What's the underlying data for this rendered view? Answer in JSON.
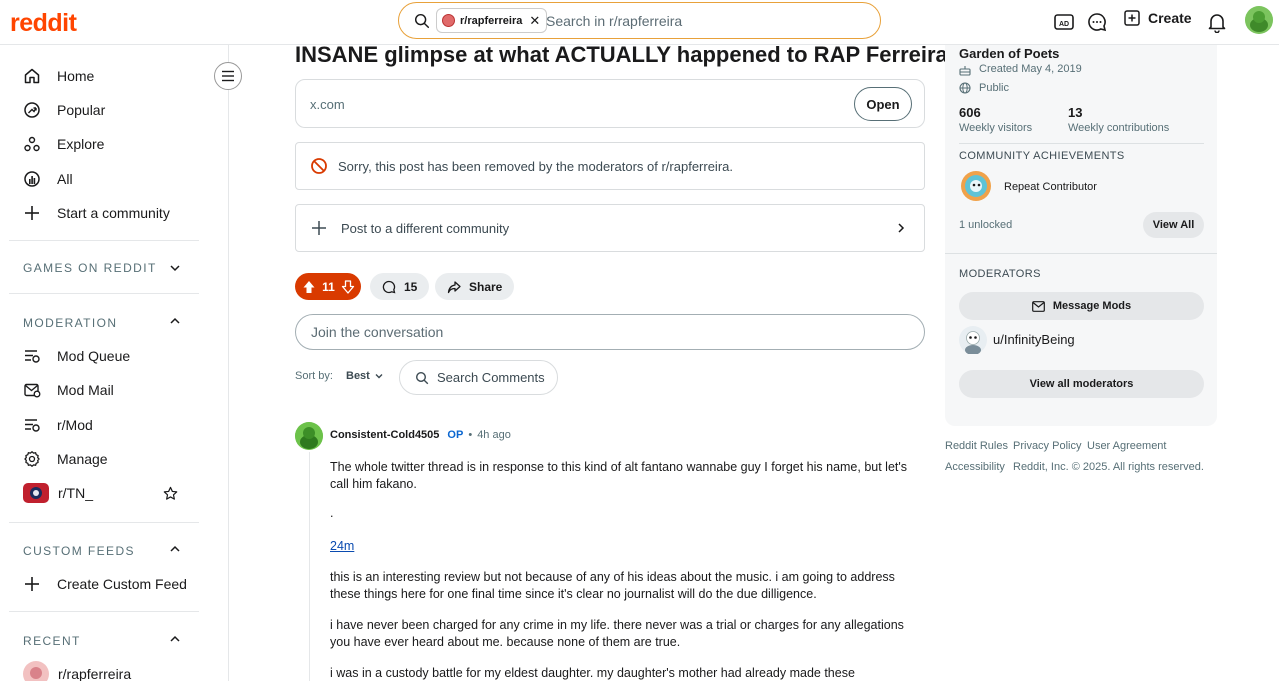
{
  "header": {
    "logo": "reddit",
    "search_chip": "r/rapferreira",
    "search_placeholder": "Search in r/rapferreira",
    "create_label": "Create"
  },
  "sidebar": {
    "nav": [
      {
        "label": "Home",
        "icon": "home-icon"
      },
      {
        "label": "Popular",
        "icon": "popular-icon"
      },
      {
        "label": "Explore",
        "icon": "explore-icon"
      },
      {
        "label": "All",
        "icon": "all-icon"
      },
      {
        "label": "Start a community",
        "icon": "plus-icon"
      }
    ],
    "games_label": "GAMES ON REDDIT",
    "moderation_label": "MODERATION",
    "moderation_items": [
      {
        "label": "Mod Queue",
        "icon": "mod-queue-icon"
      },
      {
        "label": "Mod Mail",
        "icon": "mod-mail-icon"
      },
      {
        "label": "r/Mod",
        "icon": "mod-icon"
      },
      {
        "label": "Manage",
        "icon": "gear-icon"
      },
      {
        "label": "r/TN_",
        "icon": "community-avatar"
      }
    ],
    "custom_feeds_label": "CUSTOM FEEDS",
    "create_feed_label": "Create Custom Feed",
    "recent_label": "RECENT",
    "recent_items": [
      {
        "label": "r/rapferreira"
      }
    ]
  },
  "post": {
    "title": "INSANE glimpse at what ACTUALLY happened to RAP Ferreira",
    "link_domain": "x.com",
    "open_label": "Open",
    "removed_notice": "Sorry, this post has been removed by the moderators of r/rapferreira.",
    "post_different": "Post to a different community",
    "score": "11",
    "comments_count": "15",
    "share_label": "Share",
    "join_placeholder": "Join the conversation",
    "sort_by_label": "Sort by:",
    "sort_value": "Best",
    "search_comments": "Search Comments"
  },
  "comment": {
    "author": "Consistent-Cold4505",
    "op_badge": "OP",
    "separator": "•",
    "time": "4h ago",
    "paragraphs": [
      "The whole twitter thread is in response to this kind of alt fantano wannabe guy I forget his name, but let's call him fakano.",
      ".",
      "24m",
      "this is an interesting review but not because of any of his ideas about the music. i am going to address these things here for one final time since it's clear no journalist will do the due dilligence.",
      "i have never been charged for any crime in my life. there never was a trial or charges for any allegations you have ever heard about me. because none of them are true.",
      "i was in a custody battle for my eldest daughter. my daughter's mother had already made these"
    ]
  },
  "community": {
    "name": "Garden of Poets",
    "created": "Created May 4, 2019",
    "visibility": "Public",
    "visitors_value": "606",
    "visitors_label": "Weekly visitors",
    "contrib_value": "13",
    "contrib_label": "Weekly contributions",
    "achievements_head": "COMMUNITY ACHIEVEMENTS",
    "achievement": "Repeat Contributor",
    "unlocked": "1 unlocked",
    "view_all": "View All",
    "moderators_head": "MODERATORS",
    "message_mods": "Message Mods",
    "moderator": "u/InfinityBeing",
    "view_all_mods": "View all moderators"
  },
  "footer": {
    "links": [
      "Reddit Rules",
      "Privacy Policy",
      "User Agreement",
      "Accessibility"
    ],
    "copyright": "Reddit, Inc. © 2025. All rights reserved."
  },
  "colors": {
    "brand": "#ff4500",
    "vote_bg": "#d93a00",
    "search_border": "#e8a13a",
    "link": "#0a4bb0"
  }
}
